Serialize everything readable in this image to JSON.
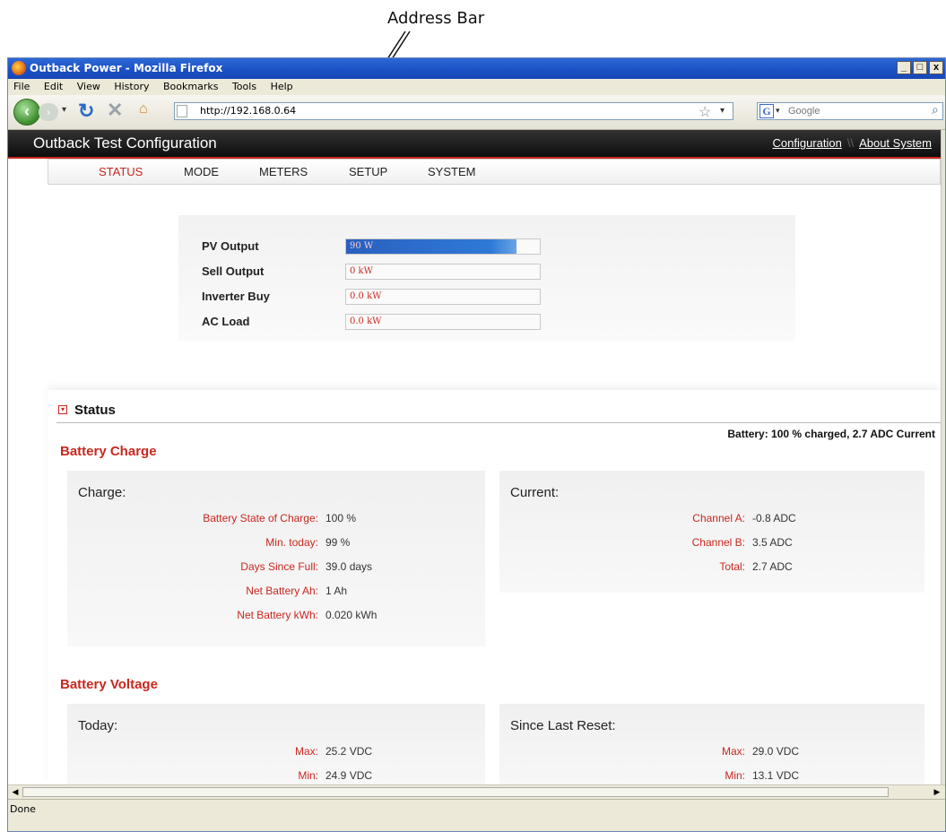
{
  "annotation": {
    "label": "Address Bar"
  },
  "window": {
    "title": "Outback Power - Mozilla Firefox",
    "controls": [
      "_",
      "□",
      "x"
    ]
  },
  "menu": [
    "File",
    "Edit",
    "View",
    "History",
    "Bookmarks",
    "Tools",
    "Help"
  ],
  "nav": {
    "url": "http://192.168.0.64",
    "search_placeholder": "Google"
  },
  "statusbar": {
    "text": "Done"
  },
  "header": {
    "title": "Outback Test Configuration",
    "links": [
      "Configuration",
      "About System"
    ],
    "separator": "\\\\"
  },
  "tabs": [
    {
      "label": "STATUS",
      "active": true
    },
    {
      "label": "MODE",
      "active": false
    },
    {
      "label": "METERS",
      "active": false
    },
    {
      "label": "SETUP",
      "active": false
    },
    {
      "label": "SYSTEM",
      "active": false
    }
  ],
  "power": [
    {
      "label": "PV Output",
      "value": "90 W",
      "fill": 0.88
    },
    {
      "label": "Sell Output",
      "value": "0 kW"
    },
    {
      "label": "Inverter Buy",
      "value": "0.0 kW"
    },
    {
      "label": "AC Load",
      "value": "0.0 kW"
    }
  ],
  "status": {
    "title": "Status",
    "summary": "Battery: 100 % charged, 2.7 ADC Current",
    "battery_charge": {
      "heading": "Battery Charge",
      "charge": {
        "title": "Charge:",
        "rows": [
          {
            "k": "Battery State of Charge:",
            "v": "100 %"
          },
          {
            "k": "Min. today:",
            "v": "99 %"
          },
          {
            "k": "Days Since Full:",
            "v": "39.0 days"
          },
          {
            "k": "Net Battery Ah:",
            "v": "1 Ah"
          },
          {
            "k": "Net Battery kWh:",
            "v": "0.020 kWh"
          }
        ]
      },
      "current": {
        "title": "Current:",
        "rows": [
          {
            "k": "Channel A:",
            "v": "-0.8 ADC"
          },
          {
            "k": "Channel B:",
            "v": "3.5 ADC"
          },
          {
            "k": "Total:",
            "v": "2.7 ADC"
          }
        ]
      }
    },
    "battery_voltage": {
      "heading": "Battery Voltage",
      "today": {
        "title": "Today:",
        "rows": [
          {
            "k": "Max:",
            "v": "25.2 VDC"
          },
          {
            "k": "Min:",
            "v": "24.9 VDC"
          }
        ]
      },
      "since_reset": {
        "title": "Since Last Reset:",
        "rows": [
          {
            "k": "Max:",
            "v": "29.0 VDC"
          },
          {
            "k": "Min:",
            "v": "13.1 VDC"
          }
        ]
      }
    }
  }
}
